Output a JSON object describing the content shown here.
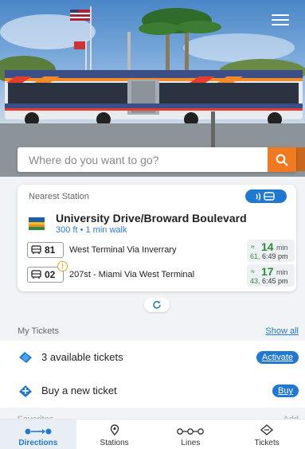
{
  "search": {
    "placeholder": "Where do you want to go?"
  },
  "nearest_station": {
    "header": "Nearest Station",
    "name": "University Drive/Broward Boulevard",
    "subtitle": "300 ft • 1 min walk",
    "routes": [
      {
        "number": "81",
        "destination": "West Terminal Via  Inverrary",
        "eta_min": "14",
        "eta_unit": "min",
        "next_route": "61,",
        "next_time": "6:49 pm",
        "alert": false
      },
      {
        "number": "02",
        "destination": "207st - Miami Via West Terminal",
        "eta_min": "17",
        "eta_unit": "min",
        "next_route": "43,",
        "next_time": "6:45 pm",
        "alert": true
      }
    ]
  },
  "my_tickets": {
    "title": "My Tickets",
    "show_all": "Show all",
    "available": {
      "label": "3 available tickets",
      "action": "Activate"
    },
    "buy": {
      "label": "Buy a new ticket",
      "action": "Buy"
    }
  },
  "faded_section": {
    "left": "Favorites",
    "right": "Add"
  },
  "tabs": [
    {
      "label": "Directions",
      "icon": "directions-icon",
      "active": true
    },
    {
      "label": "Stations",
      "icon": "location-pin-icon",
      "active": false
    },
    {
      "label": "Lines",
      "icon": "lines-icon",
      "active": false
    },
    {
      "label": "Tickets",
      "icon": "ticket-icon",
      "active": false
    }
  ],
  "colors": {
    "accent": "#1f78d1",
    "search_button": "#f07a22",
    "eta_green": "#2e8b3a"
  }
}
